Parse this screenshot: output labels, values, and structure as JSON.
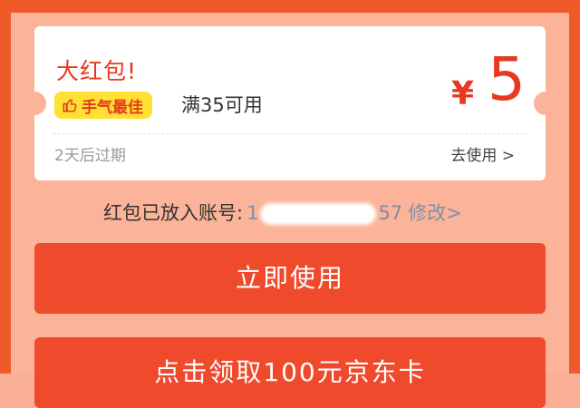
{
  "coupon": {
    "title": "大红包!",
    "badge": "手气最佳",
    "badge_icon": "thumbs-up-icon",
    "condition": "满35可用",
    "currency": "¥",
    "amount": "5",
    "expiry": "2天后过期",
    "use_link": "去使用 >"
  },
  "account": {
    "label": "红包已放入账号:",
    "masked_start": "1",
    "masked_end": "57",
    "edit_link": "修改>"
  },
  "buttons": {
    "use_now": "立即使用",
    "claim_card": "点击领取100元京东卡"
  },
  "colors": {
    "frame": "#ee5a28",
    "background": "#fbb49a",
    "accent_red": "#e8381f",
    "button": "#f04a2d",
    "badge_yellow": "#ffe033"
  }
}
